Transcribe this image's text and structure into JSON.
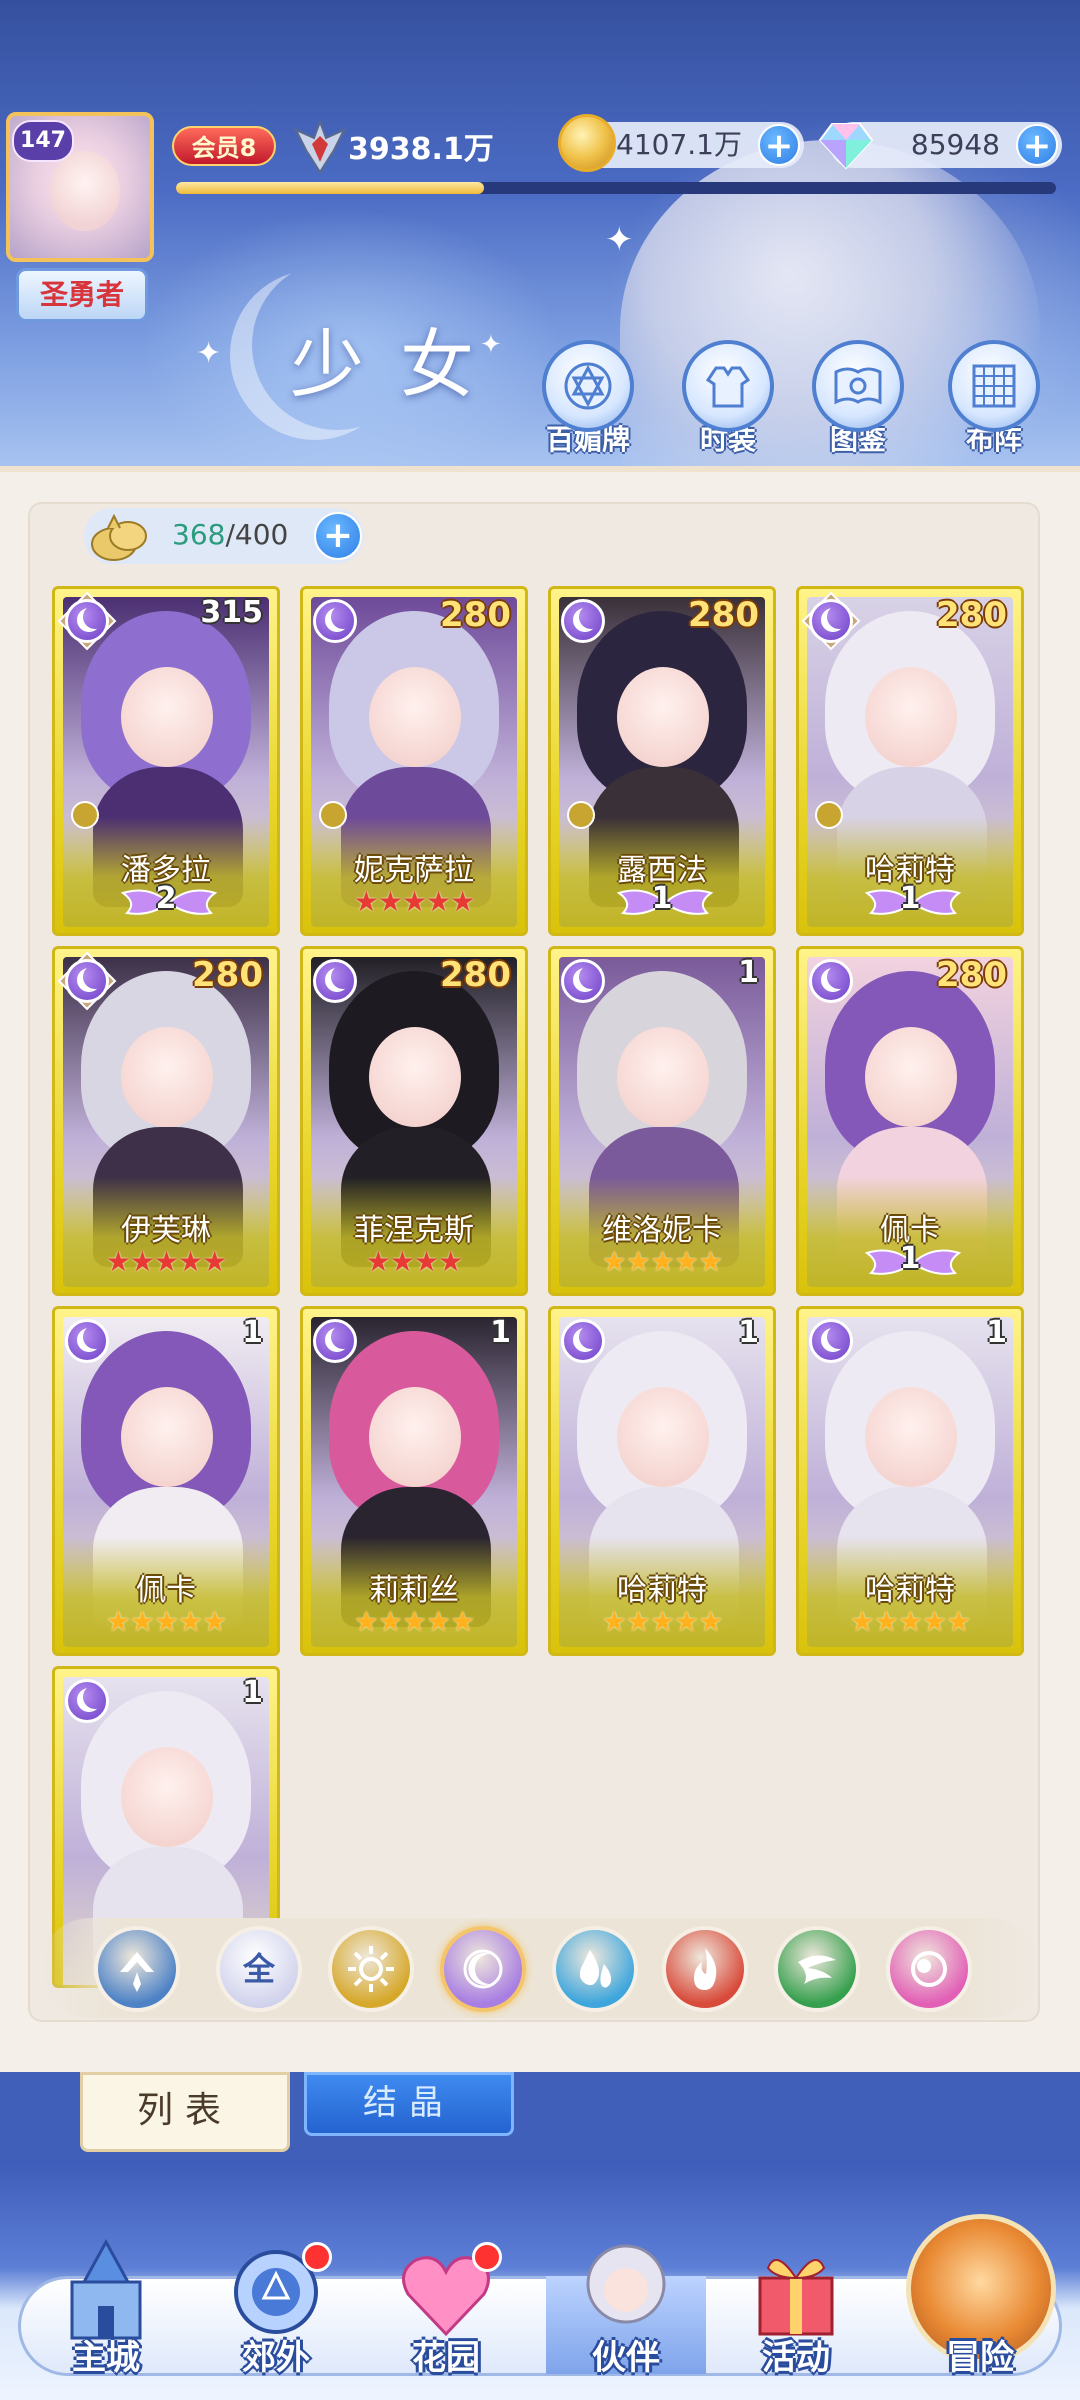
{
  "header": {
    "level": "147",
    "title_badge": "圣勇者",
    "vip": "会员8",
    "power": "3938.1万",
    "xp_progress": 0.35,
    "gold": "4107.1万",
    "gems": "85948",
    "page_title": "少女"
  },
  "top_buttons": [
    {
      "label": "百媚牌",
      "icon": "card-deck-icon"
    },
    {
      "label": "时装",
      "icon": "outfit-icon"
    },
    {
      "label": "图鉴",
      "icon": "codex-book-icon"
    },
    {
      "label": "布阵",
      "icon": "formation-grid-icon"
    }
  ],
  "capacity": {
    "current": "368",
    "max": "/400"
  },
  "cards": [
    {
      "name": "潘多拉",
      "level": "315",
      "rank_type": "wing",
      "rank": "2",
      "diamond": true,
      "role": true,
      "hair": "#8e6fd0",
      "outfit": "#4b2f72"
    },
    {
      "name": "妮克萨拉",
      "level": "280",
      "rank_type": "red-stars",
      "rank": 5,
      "diamond": false,
      "role": true,
      "hair": "#cbc7e6",
      "outfit": "#6e4a9a"
    },
    {
      "name": "露西法",
      "level": "280",
      "rank_type": "wing",
      "rank": "1",
      "diamond": false,
      "role": true,
      "hair": "#2b2540",
      "outfit": "#3a3038"
    },
    {
      "name": "哈莉特",
      "level": "280",
      "rank_type": "wing",
      "rank": "1",
      "diamond": true,
      "role": true,
      "hair": "#eeeaf3",
      "outfit": "#d8d2e6"
    },
    {
      "name": "伊芙琳",
      "level": "280",
      "rank_type": "red-stars",
      "rank": 5,
      "diamond": true,
      "role": false,
      "hair": "#d9d6e4",
      "outfit": "#3d3048"
    },
    {
      "name": "菲涅克斯",
      "level": "280",
      "rank_type": "red-stars",
      "rank": 4,
      "diamond": false,
      "role": false,
      "hair": "#1e1a22",
      "outfit": "#222026"
    },
    {
      "name": "维洛妮卡",
      "level": "1",
      "rank_type": "gold-stars",
      "rank": 5,
      "diamond": false,
      "role": false,
      "hair": "#d8d4dc",
      "outfit": "#7a5a9a"
    },
    {
      "name": "佩卡",
      "level": "280",
      "rank_type": "wing",
      "rank": "1",
      "diamond": false,
      "role": false,
      "hair": "#8458b8",
      "outfit": "#f2d2de"
    },
    {
      "name": "佩卡",
      "level": "1",
      "rank_type": "gold-stars",
      "rank": 5,
      "diamond": false,
      "role": false,
      "hair": "#8458b8",
      "outfit": "#f0ecf2"
    },
    {
      "name": "莉莉丝",
      "level": "1",
      "rank_type": "gold-stars",
      "rank": 5,
      "diamond": false,
      "role": false,
      "hair": "#d85a9c",
      "outfit": "#2a2430"
    },
    {
      "name": "哈莉特",
      "level": "1",
      "rank_type": "gold-stars",
      "rank": 5,
      "diamond": false,
      "role": false,
      "hair": "#eeeaf3",
      "outfit": "#e6e2ee"
    },
    {
      "name": "哈莉特",
      "level": "1",
      "rank_type": "gold-stars",
      "rank": 5,
      "diamond": false,
      "role": false,
      "hair": "#eeeaf3",
      "outfit": "#e6e2ee"
    },
    {
      "name": "",
      "level": "1",
      "rank_type": "none",
      "rank": 0,
      "diamond": false,
      "role": false,
      "hair": "#eeeaf3",
      "outfit": "#e6e2ee"
    }
  ],
  "filters": [
    {
      "icon": "wind-element-icon",
      "label": "",
      "color": "#4d82c6"
    },
    {
      "icon": "all-filter-icon",
      "label": "全",
      "color": "#c6c8e8"
    },
    {
      "icon": "light-element-icon",
      "label": "",
      "color": "#d6a82a"
    },
    {
      "icon": "dark-moon-element-icon",
      "label": "",
      "color": "#a87ee2"
    },
    {
      "icon": "water-element-icon",
      "label": "",
      "color": "#3ea6dc"
    },
    {
      "icon": "fire-element-icon",
      "label": "",
      "color": "#d84a3a"
    },
    {
      "icon": "nature-element-icon",
      "label": "",
      "color": "#36a04e"
    },
    {
      "icon": "spirit-element-icon",
      "label": "",
      "color": "#e25fb6"
    }
  ],
  "view_tabs": {
    "list": "列表",
    "crystal": "结晶"
  },
  "bottom_nav": [
    {
      "label": "主城",
      "icon": "castle-icon",
      "badge": false
    },
    {
      "label": "郊外",
      "icon": "portal-icon",
      "badge": true
    },
    {
      "label": "花园",
      "icon": "heart-garden-icon",
      "badge": true
    },
    {
      "label": "伙伴",
      "icon": "partner-avatar-icon",
      "badge": false
    },
    {
      "label": "活动",
      "icon": "gift-box-icon",
      "badge": false
    },
    {
      "label": "冒险",
      "icon": "compass-icon",
      "badge": false
    }
  ]
}
